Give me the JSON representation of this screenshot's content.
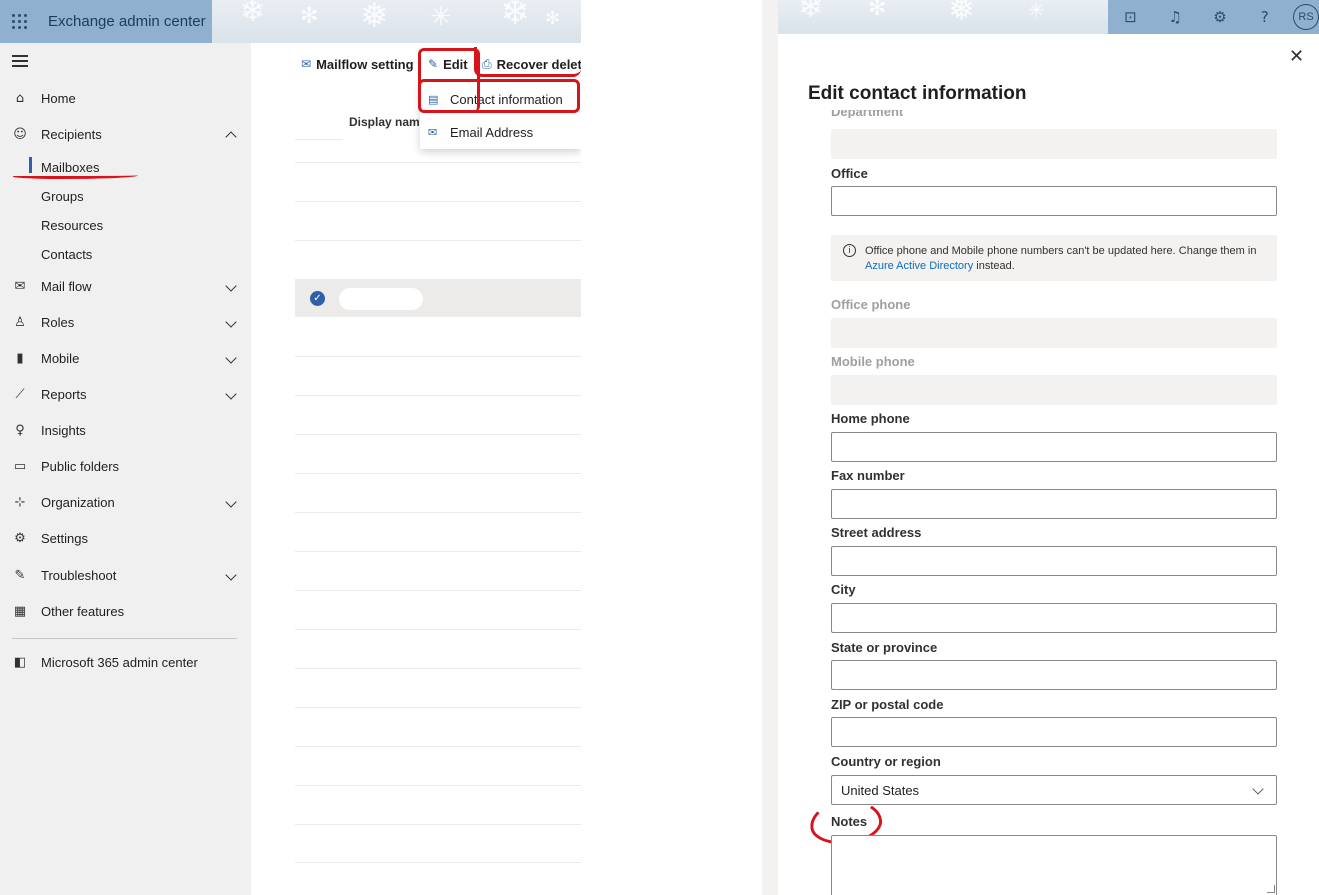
{
  "app": {
    "title": "Exchange admin center",
    "avatar_initials": "RS"
  },
  "header_icons": [
    "terminal-icon",
    "bell-icon",
    "gear-icon",
    "help-icon"
  ],
  "nav": {
    "items": [
      {
        "label": "Home",
        "icon": "home-icon"
      },
      {
        "label": "Recipients",
        "icon": "person-icon",
        "expanded": true
      },
      {
        "label": "Mail flow",
        "icon": "mail-icon"
      },
      {
        "label": "Roles",
        "icon": "roles-icon"
      },
      {
        "label": "Mobile",
        "icon": "mobile-icon"
      },
      {
        "label": "Reports",
        "icon": "chart-icon"
      },
      {
        "label": "Insights",
        "icon": "lightbulb-icon"
      },
      {
        "label": "Public folders",
        "icon": "folder-icon"
      },
      {
        "label": "Organization",
        "icon": "org-icon"
      },
      {
        "label": "Settings",
        "icon": "gear-icon"
      },
      {
        "label": "Troubleshoot",
        "icon": "wrench-icon"
      },
      {
        "label": "Other features",
        "icon": "grid-icon"
      },
      {
        "label": "Microsoft 365 admin center",
        "icon": "office-icon"
      }
    ],
    "recipients_sub": [
      "Mailboxes",
      "Groups",
      "Resources",
      "Contacts"
    ],
    "selected": "Mailboxes"
  },
  "toolbar": {
    "mailflow": "Mailflow setting",
    "edit": "Edit",
    "recover": "Recover delete"
  },
  "edit_menu": {
    "contact_information": "Contact information",
    "email_address": "Email Address"
  },
  "table": {
    "col_display_name": "Display name"
  },
  "panel": {
    "title": "Edit contact information",
    "department_label": "Department",
    "office_label": "Office",
    "info_text_before": "Office phone and Mobile phone numbers can't be updated here. Change them in ",
    "info_link": "Azure Active Directory",
    "info_text_after": " instead.",
    "office_phone_label": "Office phone",
    "mobile_phone_label": "Mobile phone",
    "home_phone_label": "Home phone",
    "fax_label": "Fax number",
    "street_label": "Street address",
    "city_label": "City",
    "state_label": "State or province",
    "zip_label": "ZIP or postal code",
    "country_label": "Country or region",
    "country_value": "United States",
    "notes_label": "Notes"
  },
  "colors": {
    "accent": "#2e61a8",
    "annotation_red": "#d7141a",
    "link": "#0f6cbd"
  }
}
